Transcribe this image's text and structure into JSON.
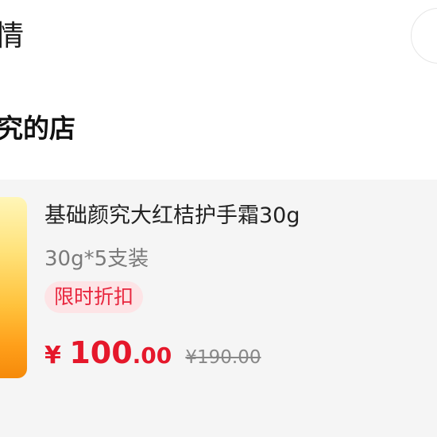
{
  "header": {
    "title": "情"
  },
  "shop": {
    "name": "究的店"
  },
  "product": {
    "title": "基础颜究大红桔护手霜30g",
    "spec": "30g*5支装",
    "promo_badge": "限时折扣",
    "price": {
      "symbol": "¥ ",
      "integer": "100",
      "decimal": ".00",
      "original": "¥190.00"
    }
  },
  "colors": {
    "accent": "#e5182b",
    "badge_bg": "#fde4e6",
    "card_bg": "#f5f5f5"
  }
}
